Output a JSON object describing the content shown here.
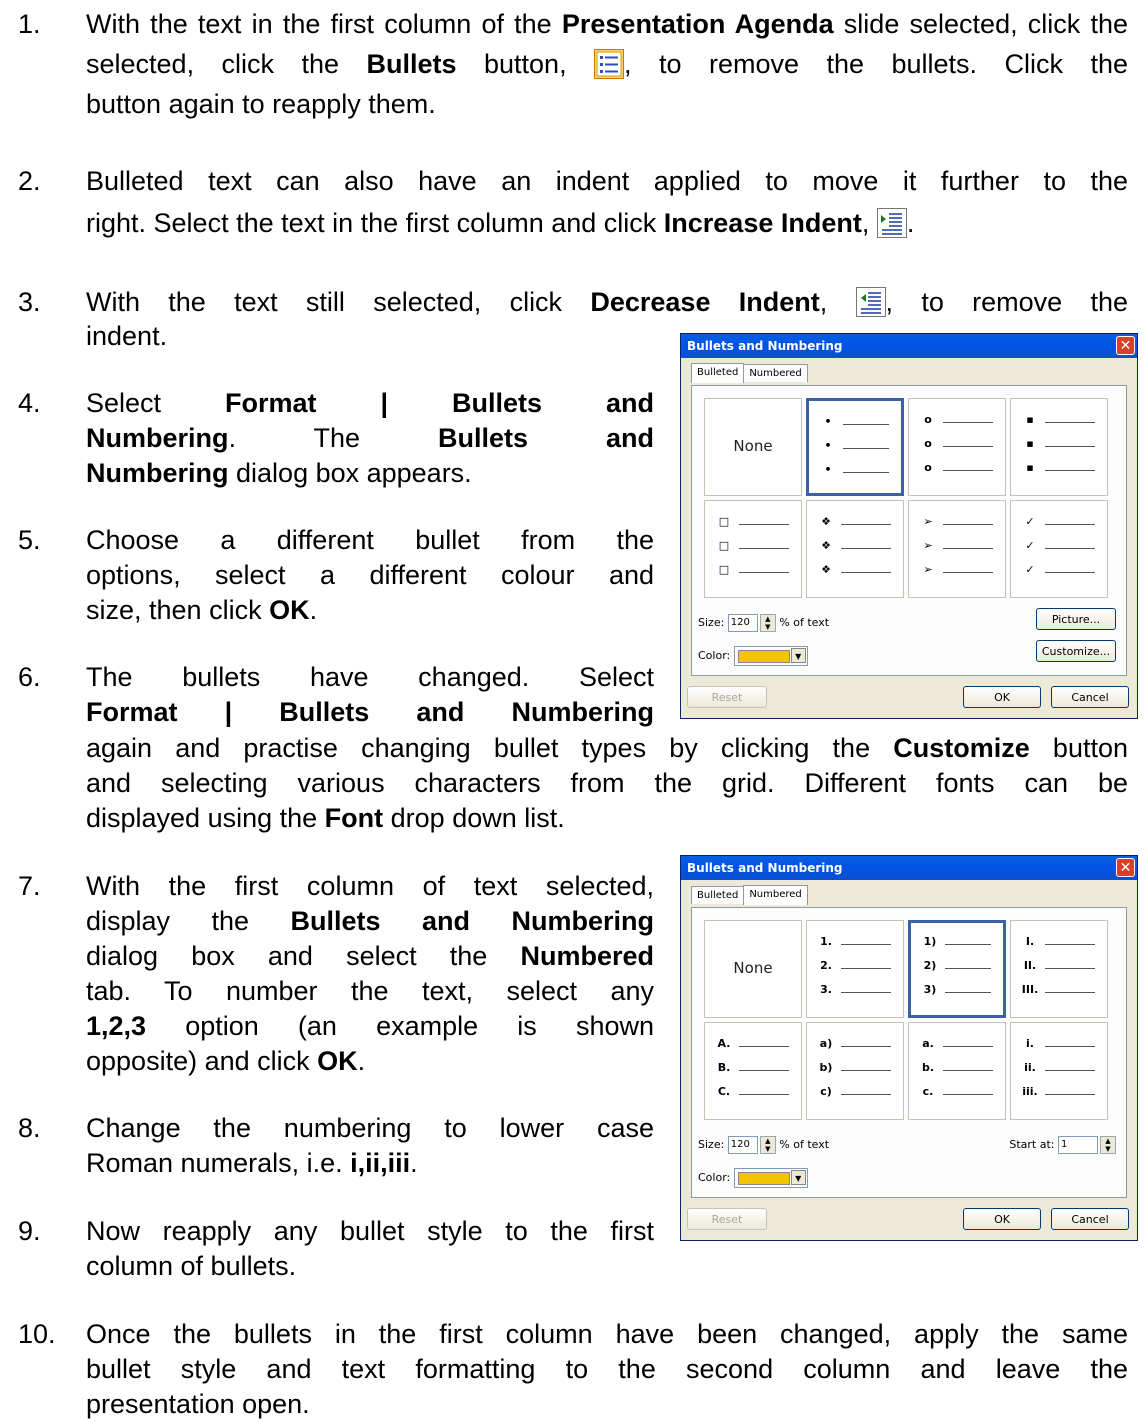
{
  "steps": [
    {
      "n": "1.",
      "t1": "With the text in the first column of the ",
      "b1": "Presentation Agenda",
      "t2": " slide selected, click the ",
      "b2": "Bullets",
      "t3": " button, ",
      "t4": ", to remove the bullets. Click the button again to reapply them."
    },
    {
      "n": "2.",
      "t1": "Bulleted text can also have an indent applied to move it further to the right. Select the text in the first column and click ",
      "b1": "Increase Indent",
      "t2": ", ",
      "t3": "."
    },
    {
      "n": "3.",
      "t1": "With the text still selected, click ",
      "b1": "Decrease Indent",
      "t2": ", ",
      "t3": ", to remove the indent."
    },
    {
      "n": "4.",
      "t1": "Select ",
      "b1": "Format | Bullets and Numbering",
      "t2": ". The ",
      "b2": "Bullets and Numbering",
      "t3": " dialog box appears."
    },
    {
      "n": "5.",
      "t1": "Choose a different bullet from the options, select a different colour and size, then click ",
      "b1": "OK",
      "t2": "."
    },
    {
      "n": "6.",
      "t1": "The bullets have changed. Select ",
      "b1": "Format | Bullets and Numbering",
      "t2": " again and practise changing bullet types by clicking the ",
      "b2": "Customize",
      "t3": " button and selecting various characters from the grid. Different fonts can be displayed using the ",
      "b3": "Font",
      "t4": " drop down list."
    },
    {
      "n": "7.",
      "t1": "With the first column of text selected, display the ",
      "b1": "Bullets and Numbering",
      "t2": " dialog box and select the ",
      "b2": "Numbered",
      "t3": " tab. To number the text, select any ",
      "b3": "1,2,3",
      "t4": " option (an example is shown opposite) and click ",
      "b4": "OK",
      "t5": "."
    },
    {
      "n": "8.",
      "t1": "Change the numbering to lower case Roman numerals, i.e. ",
      "b1": "i,ii,iii",
      "t2": "."
    },
    {
      "n": "9.",
      "t1": "Now reapply any bullet style to the first column of bullets."
    },
    {
      "n": "10.",
      "t1": "Once the bullets in the first column have been changed, apply the same bullet style and text formatting to the second column and leave the presentation open."
    }
  ],
  "icons": {
    "bullets": "bullets-icon",
    "increase_indent": "increase-indent-icon",
    "decrease_indent": "decrease-indent-icon"
  },
  "dialog1": {
    "title": "Bullets and Numbering",
    "tab1": "Bulleted",
    "tab2": "Numbered",
    "none": "None",
    "marks": [
      "•",
      "○",
      "▪",
      "□",
      "❖",
      "➢",
      "✓"
    ],
    "size_label": "Size:",
    "size_value": "120",
    "size_suffix": "% of text",
    "color_label": "Color:",
    "picture": "Picture...",
    "customize": "Customize...",
    "reset": "Reset",
    "ok": "OK",
    "cancel": "Cancel",
    "color": "#f5c400"
  },
  "dialog2": {
    "title": "Bullets and Numbering",
    "tab1": "Bulleted",
    "tab2": "Numbered",
    "none": "None",
    "col1": [
      "1.",
      "2.",
      "3."
    ],
    "col2": [
      "1)",
      "2)",
      "3)"
    ],
    "col3": [
      "I.",
      "II.",
      "III."
    ],
    "col4": [
      "A.",
      "B.",
      "C."
    ],
    "col5": [
      "a)",
      "b)",
      "c)"
    ],
    "col6": [
      "a.",
      "b.",
      "c."
    ],
    "col7": [
      "i.",
      "ii.",
      "iii."
    ],
    "size_label": "Size:",
    "size_value": "120",
    "size_suffix": "% of text",
    "start_label": "Start at:",
    "start_value": "1",
    "color_label": "Color:",
    "reset": "Reset",
    "ok": "OK",
    "cancel": "Cancel"
  }
}
